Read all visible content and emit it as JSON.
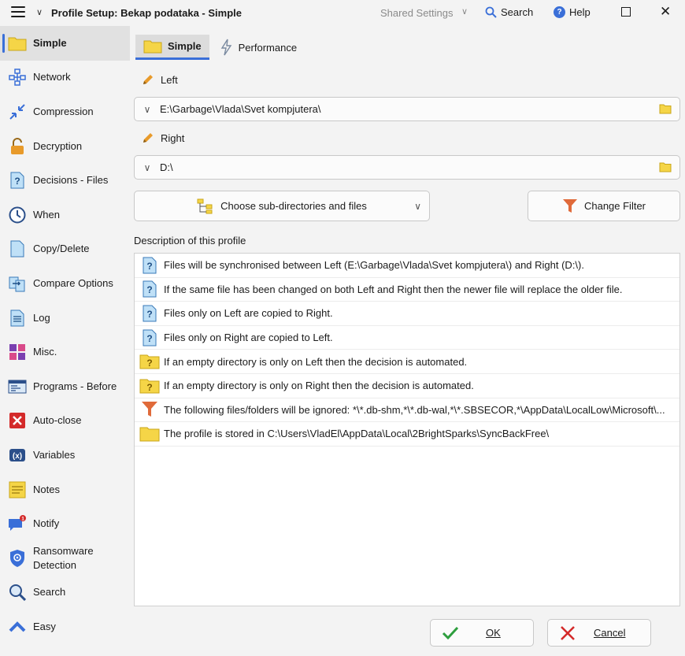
{
  "titlebar": {
    "title": "Profile Setup: Bekap podataka - Simple",
    "shared_settings": "Shared Settings",
    "search": "Search",
    "help": "Help"
  },
  "sidebar": {
    "items": [
      {
        "label": "Simple",
        "icon": "folder-icon"
      },
      {
        "label": "Network",
        "icon": "network-icon"
      },
      {
        "label": "Compression",
        "icon": "compression-icon"
      },
      {
        "label": "Decryption",
        "icon": "lock-icon"
      },
      {
        "label": "Decisions - Files",
        "icon": "question-file-icon"
      },
      {
        "label": "When",
        "icon": "clock-icon"
      },
      {
        "label": "Copy/Delete",
        "icon": "file-icon"
      },
      {
        "label": "Compare Options",
        "icon": "compare-icon"
      },
      {
        "label": "Log",
        "icon": "log-icon"
      },
      {
        "label": "Misc.",
        "icon": "misc-icon"
      },
      {
        "label": "Programs - Before",
        "icon": "programs-icon"
      },
      {
        "label": "Auto-close",
        "icon": "close-red-icon"
      },
      {
        "label": "Variables",
        "icon": "variables-icon"
      },
      {
        "label": "Notes",
        "icon": "notes-icon"
      },
      {
        "label": "Notify",
        "icon": "notify-icon",
        "badge": "1"
      },
      {
        "label": "Ransomware Detection",
        "icon": "shield-icon"
      },
      {
        "label": "Search",
        "icon": "search-icon"
      },
      {
        "label": "Easy",
        "icon": "chevron-up-icon"
      }
    ]
  },
  "tabs": [
    {
      "label": "Simple"
    },
    {
      "label": "Performance"
    }
  ],
  "left": {
    "label": "Left",
    "path": "E:\\Garbage\\Vlada\\Svet kompjutera\\"
  },
  "right": {
    "label": "Right",
    "path": "D:\\"
  },
  "buttons": {
    "choose": "Choose sub-directories and files",
    "filter": "Change Filter",
    "ok": "OK",
    "cancel": "Cancel"
  },
  "description": {
    "label": "Description of this profile",
    "rows": [
      {
        "icon": "question-file-icon",
        "text": "Files will be synchronised between Left (E:\\Garbage\\Vlada\\Svet kompjutera\\) and Right (D:\\)."
      },
      {
        "icon": "question-file-icon",
        "text": "If the same file has been changed on both Left and Right then the newer file will replace the older file."
      },
      {
        "icon": "question-file-icon",
        "text": "Files only on Left are copied to Right."
      },
      {
        "icon": "question-file-icon",
        "text": "Files only on Right are copied to Left."
      },
      {
        "icon": "question-folder-icon",
        "text": "If an empty directory is only on Left then the decision is automated."
      },
      {
        "icon": "question-folder-icon",
        "text": "If an empty directory is only on Right then the decision is automated."
      },
      {
        "icon": "filter-icon",
        "text": "The following files/folders will be ignored: *\\*.db-shm,*\\*.db-wal,*\\*.SBSECOR,*\\AppData\\LocalLow\\Microsoft\\..."
      },
      {
        "icon": "folder-icon",
        "text": "The profile is stored in C:\\Users\\VladEl\\AppData\\Local\\2BrightSparks\\SyncBackFree\\"
      }
    ]
  },
  "colors": {
    "accent": "#3a6fd8",
    "folder": "#f5d547",
    "filter": "#e06a3a",
    "ok_check": "#2e9e3e",
    "cancel_x": "#d42a2a"
  }
}
